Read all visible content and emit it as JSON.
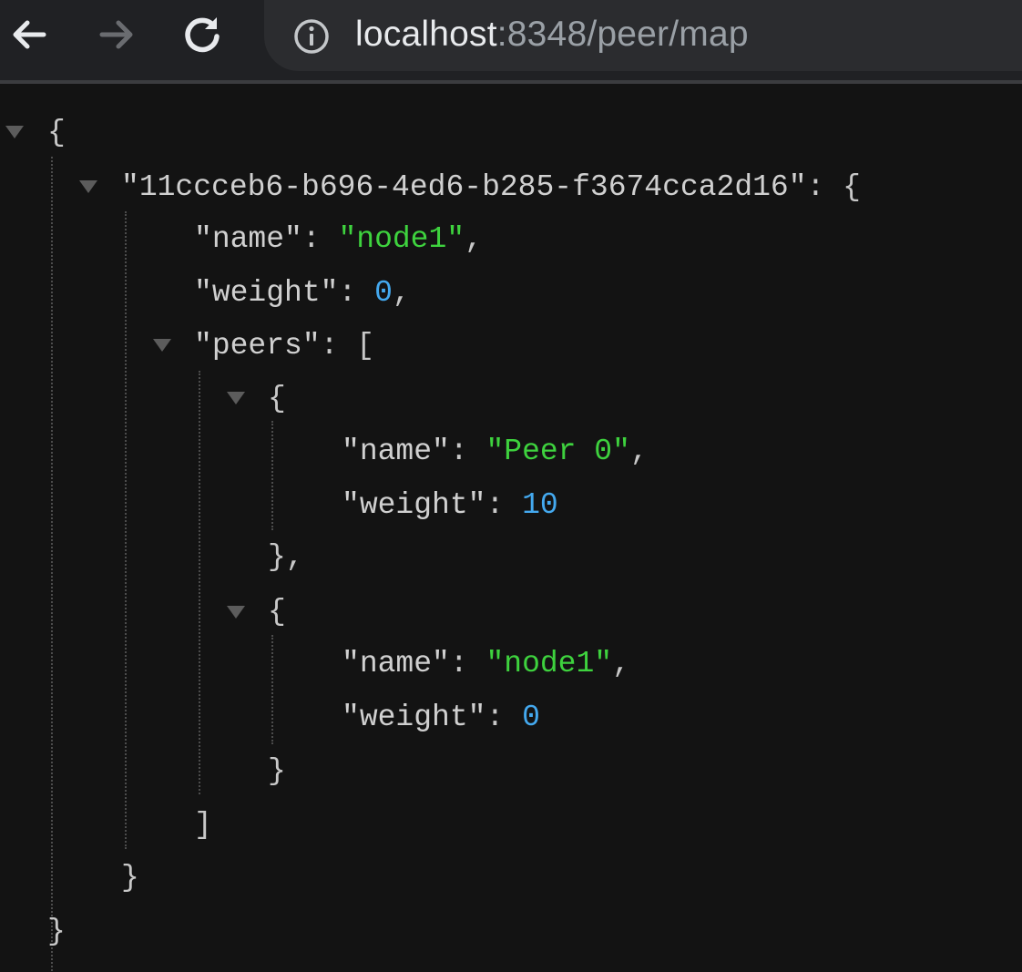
{
  "browser": {
    "url_host": "localhost",
    "url_path": ":8348/peer/map",
    "back_icon": "back-arrow-icon",
    "forward_icon": "forward-arrow-icon",
    "reload_icon": "reload-icon",
    "info_icon": "info-icon"
  },
  "json_view": {
    "root_key": "11ccceb6-b696-4ed6-b285-f3674cca2d16",
    "node_name_key": "name",
    "node_name_value": "node1",
    "node_weight_key": "weight",
    "node_weight_value": "0",
    "peers_key": "peers",
    "peers": [
      {
        "name_key": "name",
        "name_value": "Peer 0",
        "weight_key": "weight",
        "weight_value": "10"
      },
      {
        "name_key": "name",
        "name_value": "node1",
        "weight_key": "weight",
        "weight_value": "0"
      }
    ]
  },
  "colors": {
    "background": "#131313",
    "toolbar": "#202124",
    "string": "#3ed23e",
    "number": "#44a9ef",
    "key": "#d0d0d0"
  }
}
